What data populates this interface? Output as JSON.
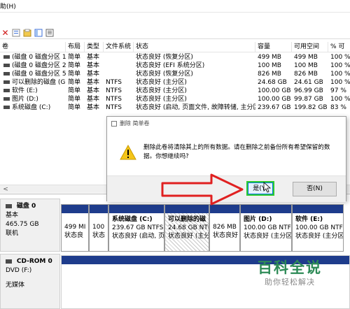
{
  "menu": {
    "help_label": "助(H)"
  },
  "toolbar": {
    "icons": [
      "delete-icon",
      "properties-icon",
      "help-icon",
      "view-icon"
    ]
  },
  "volume_list": {
    "headers": [
      "卷",
      "布局",
      "类型",
      "文件系统",
      "状态",
      "容量",
      "可用空间",
      "% 可"
    ],
    "rows": [
      [
        "(磁盘 0 磁盘分区 1)",
        "简单",
        "基本",
        "",
        "状态良好 (恢复分区)",
        "499 MB",
        "499 MB",
        "100 %"
      ],
      [
        "(磁盘 0 磁盘分区 2)",
        "简单",
        "基本",
        "",
        "状态良好 (EFI 系统分区)",
        "100 MB",
        "100 MB",
        "100 %"
      ],
      [
        "(磁盘 0 磁盘分区 5)",
        "简单",
        "基本",
        "",
        "状态良好 (恢复分区)",
        "826 MB",
        "826 MB",
        "100 %"
      ],
      [
        "可以删除的磁盘 (G:)",
        "简单",
        "基本",
        "NTFS",
        "状态良好 (主分区)",
        "24.68 GB",
        "24.61 GB",
        "100 %"
      ],
      [
        "软件 (E:)",
        "简单",
        "基本",
        "NTFS",
        "状态良好 (主分区)",
        "100.00 GB",
        "96.99 GB",
        "97 %"
      ],
      [
        "图片 (D:)",
        "简单",
        "基本",
        "NTFS",
        "状态良好 (主分区)",
        "100.00 GB",
        "99.87 GB",
        "100 %"
      ],
      [
        "系统磁盘 (C:)",
        "简单",
        "基本",
        "NTFS",
        "状态良好 (启动, 页面文件, 故障转储, 主分区)",
        "239.67 GB",
        "199.82 GB",
        "83 %"
      ]
    ]
  },
  "disk0": {
    "title": "磁盘 0",
    "type": "基本",
    "size": "465.75 GB",
    "status": "联机",
    "partitions": [
      {
        "name": "",
        "size": "499 MI",
        "status": "状态良"
      },
      {
        "name": "",
        "size": "100",
        "status": "状态"
      },
      {
        "name": "系统磁盘 (C:)",
        "size": "239.67 GB NTFS",
        "status": "状态良好 (启动, 页"
      },
      {
        "name": "可以删除的磁",
        "size": "24.68 GB NTFS",
        "status": "状态良好 (主分"
      },
      {
        "name": "",
        "size": "826 MB",
        "status": "状态良好"
      },
      {
        "name": "图片 (D:)",
        "size": "100.00 GB NTFS",
        "status": "状态良好 (主分区"
      },
      {
        "name": "软件 (E:)",
        "size": "100.00 GB NTFS",
        "status": "状态良好 (主分区"
      }
    ]
  },
  "cdrom": {
    "title": "CD-ROM 0",
    "type": "DVD (F:)",
    "media": "无媒体"
  },
  "dialog": {
    "title": "删除 简单卷",
    "message": "删除此卷将清除其上的所有数据。请在删除之前备份所有希望保留的数据。你想继续吗?",
    "yes_label": "是(Y)",
    "no_label": "否(N)"
  },
  "watermark": {
    "title": "百科全说",
    "subtitle": "助你轻松解决"
  },
  "colors": {
    "partition_bar": "#1e3c8c",
    "highlight": "#2fcc2f",
    "arrow": "#e02020",
    "watermark": "#2e8b57"
  }
}
